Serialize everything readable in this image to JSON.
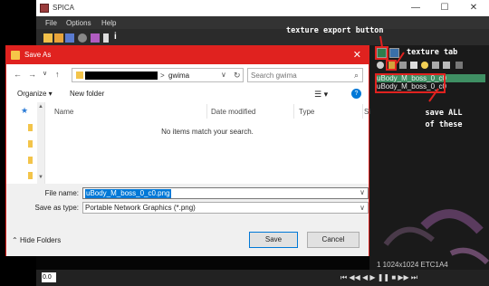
{
  "app": {
    "title": "SPICA",
    "menu": [
      "File",
      "Options",
      "Help"
    ],
    "window_controls": [
      "—",
      "☐",
      "✕"
    ]
  },
  "side_panel": {
    "textures": [
      "uBody_M_boss_0_c0",
      "uBody_M_boss_0_c0"
    ],
    "info": "1 1024x1024 ETC1A4"
  },
  "annotations": {
    "export": "texture export button",
    "tab": "texture tab",
    "save_all": "save ALL\nof these"
  },
  "dialog": {
    "title": "Save As",
    "close": "✕",
    "nav": {
      "back": "←",
      "forward": "→",
      "recent": "∨",
      "up": "↑"
    },
    "path_current": "gwima",
    "search_placeholder": "Search gwima",
    "toolbar": {
      "organize": "Organize ▾",
      "new_folder": "New folder"
    },
    "columns": [
      "Name",
      "Date modified",
      "Type",
      "Si"
    ],
    "empty_message": "No items match your search.",
    "file_name_label": "File name:",
    "file_name_value": "uBody_M_boss_0_c0.png",
    "save_type_label": "Save as type:",
    "save_type_value": "Portable Network Graphics (*.png)",
    "hide_folders": "Hide Folders",
    "save_button": "Save",
    "cancel_button": "Cancel"
  },
  "bottom": {
    "frame_value": "0.0"
  },
  "colors": {
    "accent_red": "#e0221f",
    "selection_green": "#3f8f63",
    "win_blue": "#0078d7"
  }
}
